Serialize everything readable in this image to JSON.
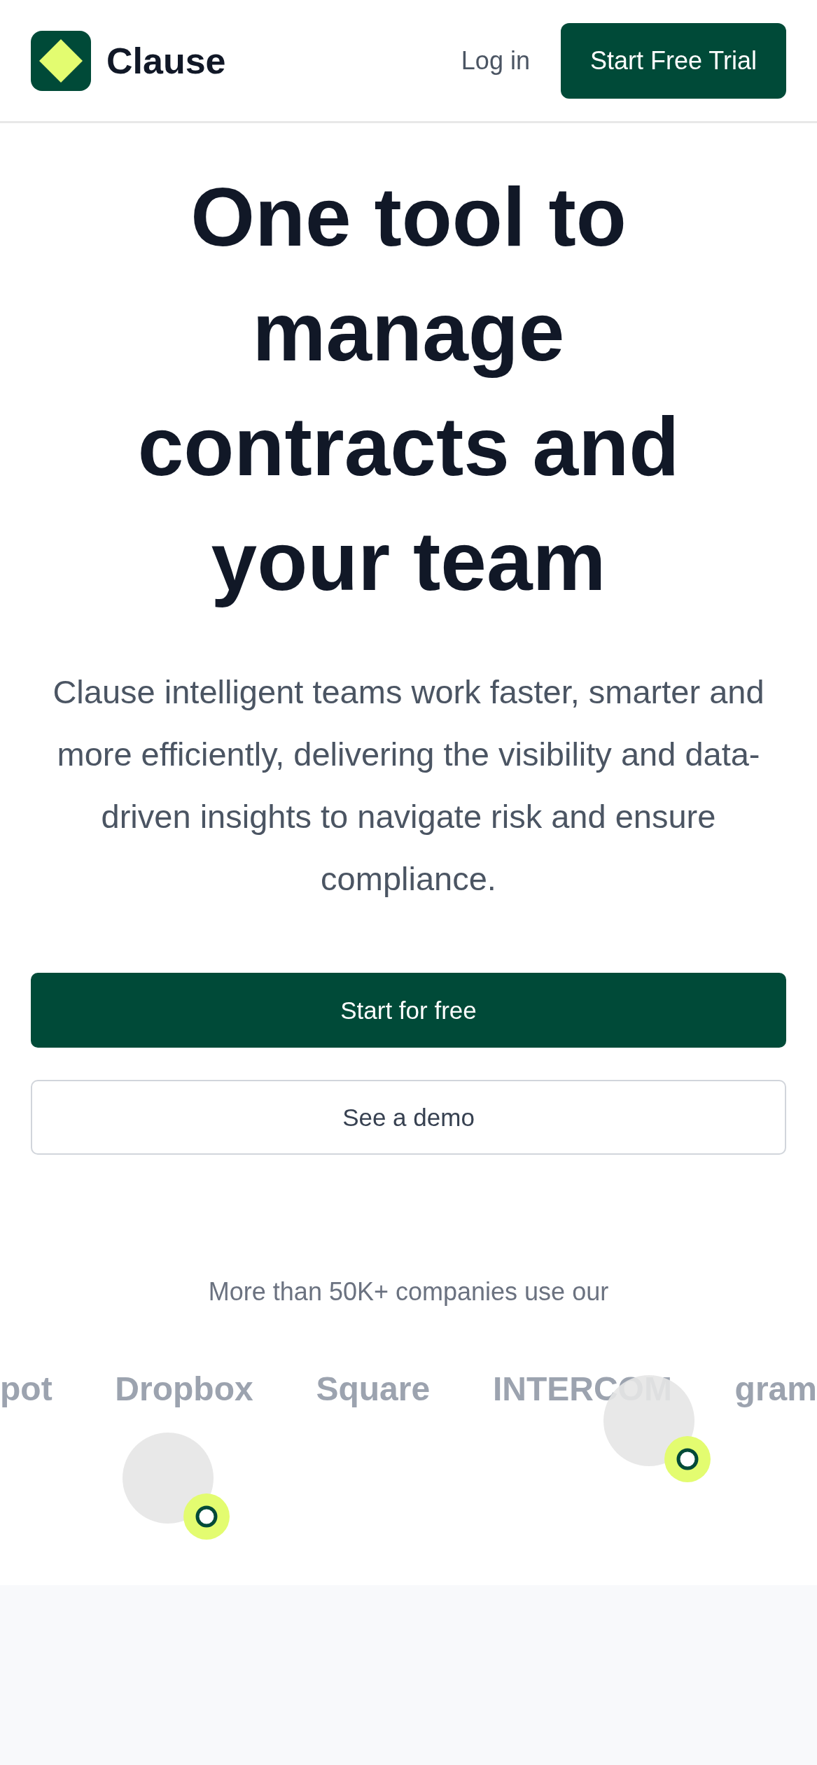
{
  "header": {
    "brand": "Clause",
    "login_link": "Log in",
    "cta_button": "Start Free Trial"
  },
  "hero": {
    "title": "One tool to manage contracts and your team",
    "description": "Clause intelligent teams work faster, smarter and more efficiently, delivering the visibility and data-driven insights to navigate risk and ensure compliance.",
    "primary_button": "Start for free",
    "secondary_button": "See a demo"
  },
  "social_proof": {
    "caption": "More than 50K+ companies use our",
    "logos": [
      "pot",
      "Dropbox",
      "Square",
      "INTERCOM",
      "gram"
    ]
  }
}
